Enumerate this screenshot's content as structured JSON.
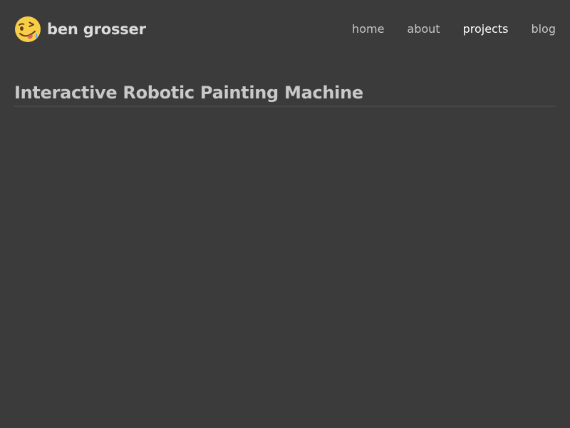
{
  "site": {
    "name": "ben grosser",
    "logo_icon": "winking-tongue-face-icon"
  },
  "nav": {
    "items": [
      {
        "label": "home",
        "active": false
      },
      {
        "label": "about",
        "active": false
      },
      {
        "label": "projects",
        "active": true
      },
      {
        "label": "blog",
        "active": false
      }
    ]
  },
  "page": {
    "title": "Interactive Robotic Painting Machine"
  },
  "colors": {
    "background": "#3b3b3b",
    "text": "#c9c9c9",
    "nav_active": "#ffffff",
    "logo_face": "#f7ce46"
  }
}
